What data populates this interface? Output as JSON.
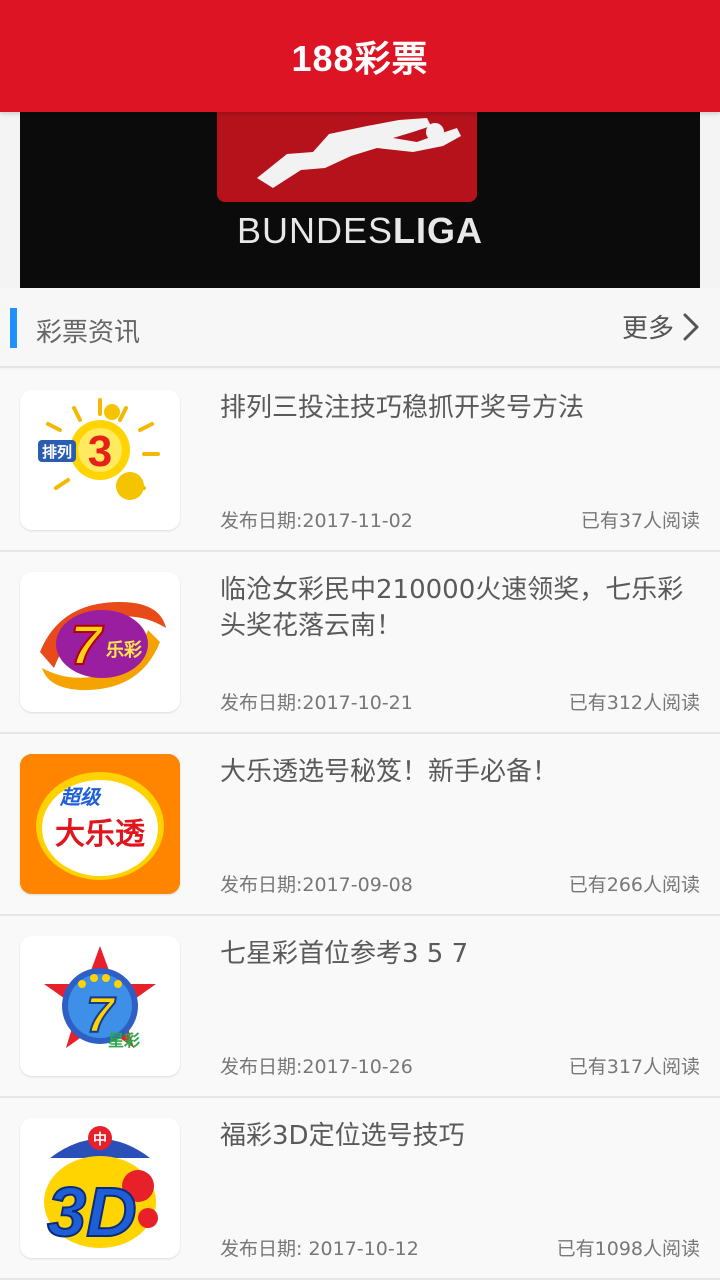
{
  "header": {
    "title": "188彩票"
  },
  "banner": {
    "text_a": "BUNDES",
    "text_b": "LIGA"
  },
  "section": {
    "title": "彩票资讯",
    "more_label": "更多"
  },
  "articles": [
    {
      "icon": "pailie3-logo-icon",
      "title": "排列三投注技巧稳抓开奖号方法",
      "date": "发布日期:2017-11-02",
      "reads": "已有37人阅读"
    },
    {
      "icon": "qilecai-logo-icon",
      "title": "临沧女彩民中210000火速领奖，七乐彩头奖花落云南！",
      "date": "发布日期:2017-10-21",
      "reads": "已有312人阅读"
    },
    {
      "icon": "daletou-logo-icon",
      "title": "大乐透选号秘笈！新手必备！",
      "date": "发布日期:2017-09-08",
      "reads": "已有266人阅读"
    },
    {
      "icon": "qixingcai-logo-icon",
      "title": "七星彩首位参考3 5 7",
      "date": "发布日期:2017-10-26",
      "reads": "已有317人阅读"
    },
    {
      "icon": "fucai3d-logo-icon",
      "title": "福彩3D定位选号技巧",
      "date": "发布日期: 2017-10-12",
      "reads": "已有1098人阅读"
    }
  ],
  "logos": {
    "pailie_text": "排列",
    "pailie_num": "3",
    "qile_num": "7",
    "qile_text": "乐彩",
    "daletou_top": "超级",
    "daletou_main": "大乐透",
    "qixing_num": "7",
    "qixing_text": "星彩",
    "fucai_zhong": "中",
    "fucai_text": "3D"
  },
  "colors": {
    "header_red": "#dc1424",
    "accent_blue": "#1e90ff"
  }
}
